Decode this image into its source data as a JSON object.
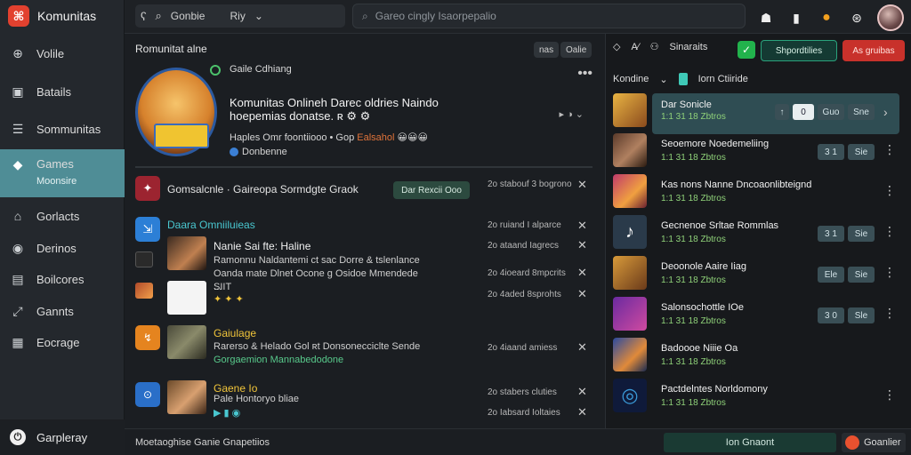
{
  "app": {
    "name": "Komunitas"
  },
  "sidebar": {
    "items": [
      {
        "label": "Volile",
        "icon": "globe-icon",
        "glyph": "⊕"
      },
      {
        "label": "Batails",
        "icon": "image-icon",
        "glyph": "▣"
      },
      {
        "label": "Sommunitas",
        "icon": "list-icon",
        "glyph": "☰"
      },
      {
        "label": "Games",
        "sub": "Moonsire",
        "icon": "gamepad-icon",
        "glyph": "◆"
      },
      {
        "label": "Gorlacts",
        "icon": "home-icon",
        "glyph": "⌂"
      },
      {
        "label": "Derinos",
        "icon": "circle-icon",
        "glyph": "◉"
      },
      {
        "label": "Boilcores",
        "icon": "box-icon",
        "glyph": "▤"
      },
      {
        "label": "Gannts",
        "icon": "chart-icon",
        "glyph": "⤢"
      },
      {
        "label": "Eocrage",
        "icon": "grid-icon",
        "glyph": "▦"
      }
    ],
    "footer": {
      "label": "Garpleray",
      "glyph": "⏻"
    }
  },
  "topbar": {
    "group_label_1": "Gonbie",
    "group_label_2": "Riy",
    "search_placeholder": "Gareo cingly Isaorpepalio"
  },
  "main": {
    "header": "Romunitat alne",
    "chips": [
      "nas",
      "Oalie"
    ],
    "hero": {
      "label": "Gaile Cdhiang",
      "title": "Komunitas Onlineh Darec oldries Naindo hoepemias donatse. ʀ ⚙ ⚙",
      "sub_prefix": "Haples Omr foontiiooo • Gop ",
      "sub_accent": "Ealsahol",
      "sub_emoji": "😀😀😀",
      "tag": "Donbenne"
    },
    "rows": [
      {
        "title": "Gomsalcnle · Gaireopa Sormdgte Graok",
        "time": "2o stabouf 3 bogrono",
        "pill": "Dar Rexcii Ooo"
      },
      {
        "title": "Daara Omniiluieas",
        "time": "2o ruiand I alparce"
      },
      {
        "title": "Nanie Sai fte: Haline",
        "time": "2o ataand Iagrecs",
        "body": "Ramonnu Naldantemi ct sac Dorre & tslenlance Oanda mate Dlnet Ocone g Osidoe Mmendede ...",
        "tag": "SIIT"
      },
      {
        "title": "",
        "time": "2o 4ioeard 8mpcrits"
      },
      {
        "title": "",
        "time": "2o 4aded 8sprohts"
      },
      {
        "title": "Gaiulage",
        "time": "2o 4iaand amiess",
        "body": "Rarerso & Helado Gol ʀt Donsonecciclte Sende",
        "tag_green": "Gorgaemion Mannabedodone"
      },
      {
        "title": "Gaene Io",
        "time": "2o stabers cluties",
        "body": "Pale Hontoryo bliae"
      },
      {
        "title": "",
        "time": "2o Iabsard Ioltaies"
      }
    ],
    "footer": "Moetaoghise Ganie Gnapetiios"
  },
  "rpanel": {
    "top_label": "Sinaraits",
    "btn_outline": "Shpordtilies",
    "btn_red": "As gruibas",
    "sub_label": "Kondine",
    "sub_right": "Iorn Ctiiride",
    "items": [
      {
        "name": "Dar Sonicle",
        "meta": "1:1 31 18 Zbtros",
        "buttons": [
          "0",
          "Guo",
          "Sne"
        ]
      },
      {
        "name": "Seoemore Noedemeliing",
        "meta": "1:1 31 18 Zbtros",
        "buttons": [
          "3 1",
          "Sie"
        ]
      },
      {
        "name": "Kas nons Nanne Dncoaonlibteignd",
        "meta": "1:1 31 18 Zbtros",
        "buttons": []
      },
      {
        "name": "Gecnenoe Srltae Rommlas",
        "meta": "1:1 31 18 Zbtros",
        "buttons": [
          "3 1",
          "Sie"
        ]
      },
      {
        "name": "Deoonole Aaire Iiag",
        "meta": "1:1 31 18 Zbtros",
        "buttons": [
          "Ele",
          "Sie"
        ]
      },
      {
        "name": "Salonsochottle IOe",
        "meta": "1:1 31 18 Zbtros",
        "buttons": [
          "3 0",
          "Sle"
        ]
      },
      {
        "name": "Badoooe Niiie Oa",
        "meta": "1:1 31 18 Zbtros",
        "buttons": []
      },
      {
        "name": "Pactdelntes Norldomony",
        "meta": "1:1 31 18 Zbtros",
        "buttons": []
      }
    ],
    "footer_btn": "Ion Gnaont",
    "footer_btn2": "Goanlier"
  }
}
